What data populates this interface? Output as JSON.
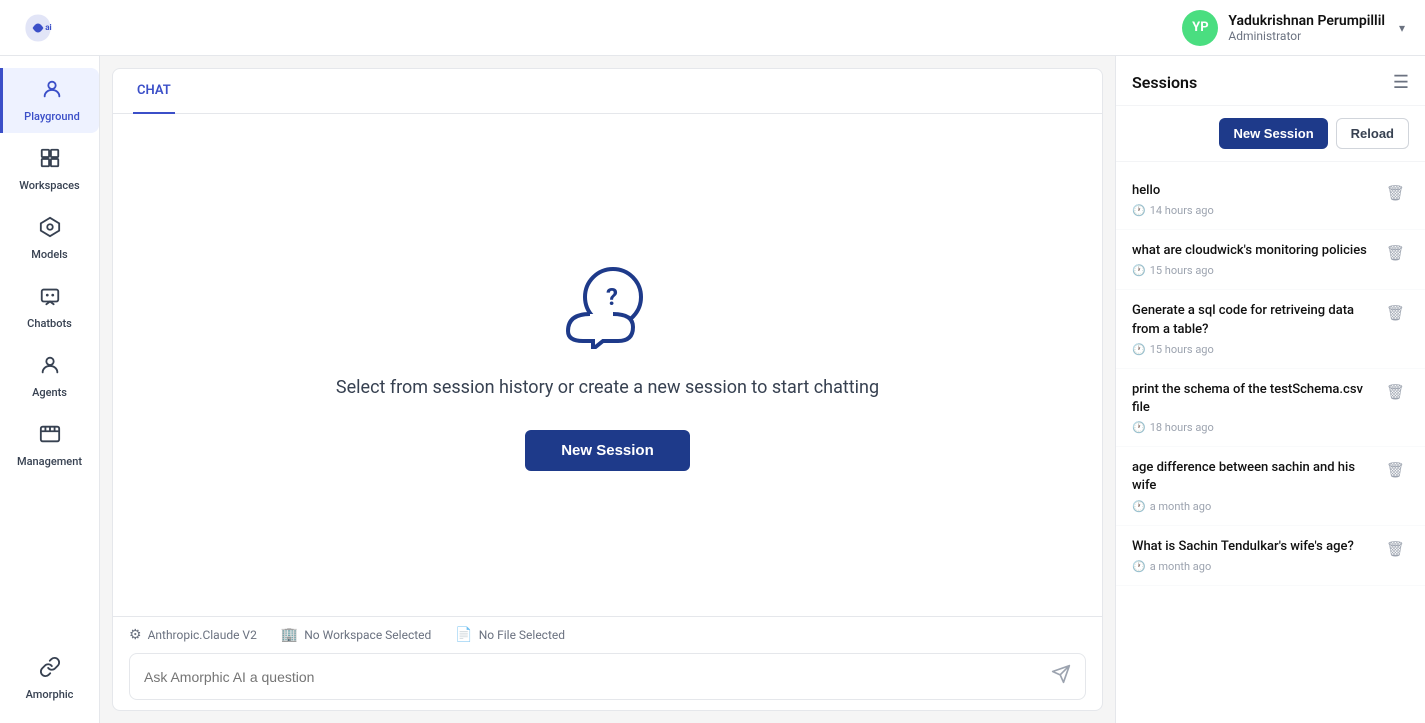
{
  "header": {
    "logo_alt": "Amorphic AI",
    "user_initials": "YP",
    "user_name": "Yadukrishnan Perumpillil",
    "user_role": "Administrator"
  },
  "sidebar": {
    "items": [
      {
        "id": "playground",
        "label": "Playground",
        "icon": "💬",
        "active": true
      },
      {
        "id": "workspaces",
        "label": "Workspaces",
        "icon": "⊞",
        "active": false
      },
      {
        "id": "models",
        "label": "Models",
        "icon": "⚡",
        "active": false
      },
      {
        "id": "chatbots",
        "label": "Chatbots",
        "icon": "🤖",
        "active": false
      },
      {
        "id": "agents",
        "label": "Agents",
        "icon": "👤",
        "active": false
      },
      {
        "id": "management",
        "label": "Management",
        "icon": "🗄",
        "active": false
      }
    ],
    "bottom_item": {
      "id": "link",
      "label": "Amorphic",
      "icon": "🔗"
    }
  },
  "chat": {
    "tab_label": "CHAT",
    "empty_text": "Select from session history or create a new session to start chatting",
    "new_session_label": "New Session",
    "model_label": "Anthropic.Claude V2",
    "workspace_label": "No Workspace Selected",
    "file_label": "No File Selected",
    "input_placeholder": "Ask Amorphic AI a question"
  },
  "sessions": {
    "title": "Sessions",
    "new_session_btn": "New Session",
    "reload_btn": "Reload",
    "items": [
      {
        "id": 1,
        "title": "hello",
        "time": "14 hours ago",
        "wrap": false
      },
      {
        "id": 2,
        "title": "what are cloudwick's monitoring policies",
        "time": "15 hours ago",
        "wrap": true
      },
      {
        "id": 3,
        "title": "Generate a sql code for retriveing data from a table?",
        "time": "15 hours ago",
        "wrap": true
      },
      {
        "id": 4,
        "title": "print the schema of the testSchema.csv file",
        "time": "18 hours ago",
        "wrap": true
      },
      {
        "id": 5,
        "title": "age difference between sachin and his wife",
        "time": "a month ago",
        "wrap": true
      },
      {
        "id": 6,
        "title": "What is Sachin Tendulkar's wife's age?",
        "time": "a month ago",
        "wrap": true
      }
    ]
  }
}
